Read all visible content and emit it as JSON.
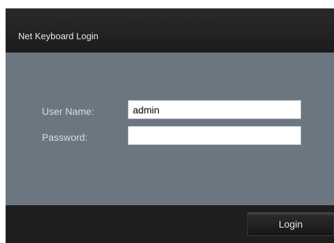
{
  "window": {
    "title": "Net Keyboard Login"
  },
  "form": {
    "username_label": "User Name:",
    "username_value": "admin",
    "password_label": "Password:",
    "password_value": ""
  },
  "footer": {
    "login_label": "Login"
  },
  "colors": {
    "titlebar": "#1e1e1e",
    "panel": "#6b7680",
    "label_text": "#d8dde2",
    "button_text": "#e6e6e6"
  }
}
